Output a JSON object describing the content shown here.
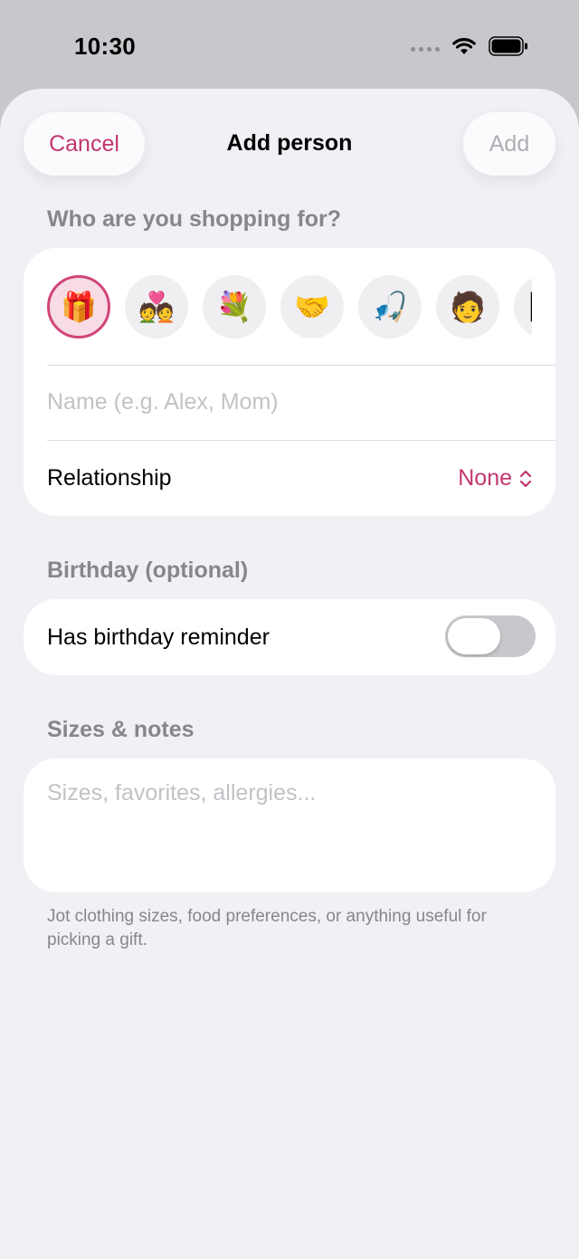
{
  "status_bar": {
    "time": "10:30"
  },
  "header": {
    "cancel_label": "Cancel",
    "title": "Add person",
    "add_label": "Add"
  },
  "shopping_section": {
    "label": "Who are you shopping for?",
    "emojis": [
      "🎁",
      "💑",
      "💐",
      "🤝",
      "🎣",
      "🧑",
      "🖼"
    ],
    "selected_index": 0,
    "name_placeholder": "Name (e.g. Alex, Mom)",
    "relationship_label": "Relationship",
    "relationship_value": "None"
  },
  "birthday_section": {
    "label": "Birthday (optional)",
    "reminder_label": "Has birthday reminder",
    "reminder_on": false
  },
  "notes_section": {
    "label": "Sizes & notes",
    "placeholder": "Sizes, favorites, allergies...",
    "footnote": "Jot clothing sizes, food preferences, or anything useful for picking a gift."
  },
  "colors": {
    "accent": "#c2366f",
    "background": "#f0f0f5"
  }
}
